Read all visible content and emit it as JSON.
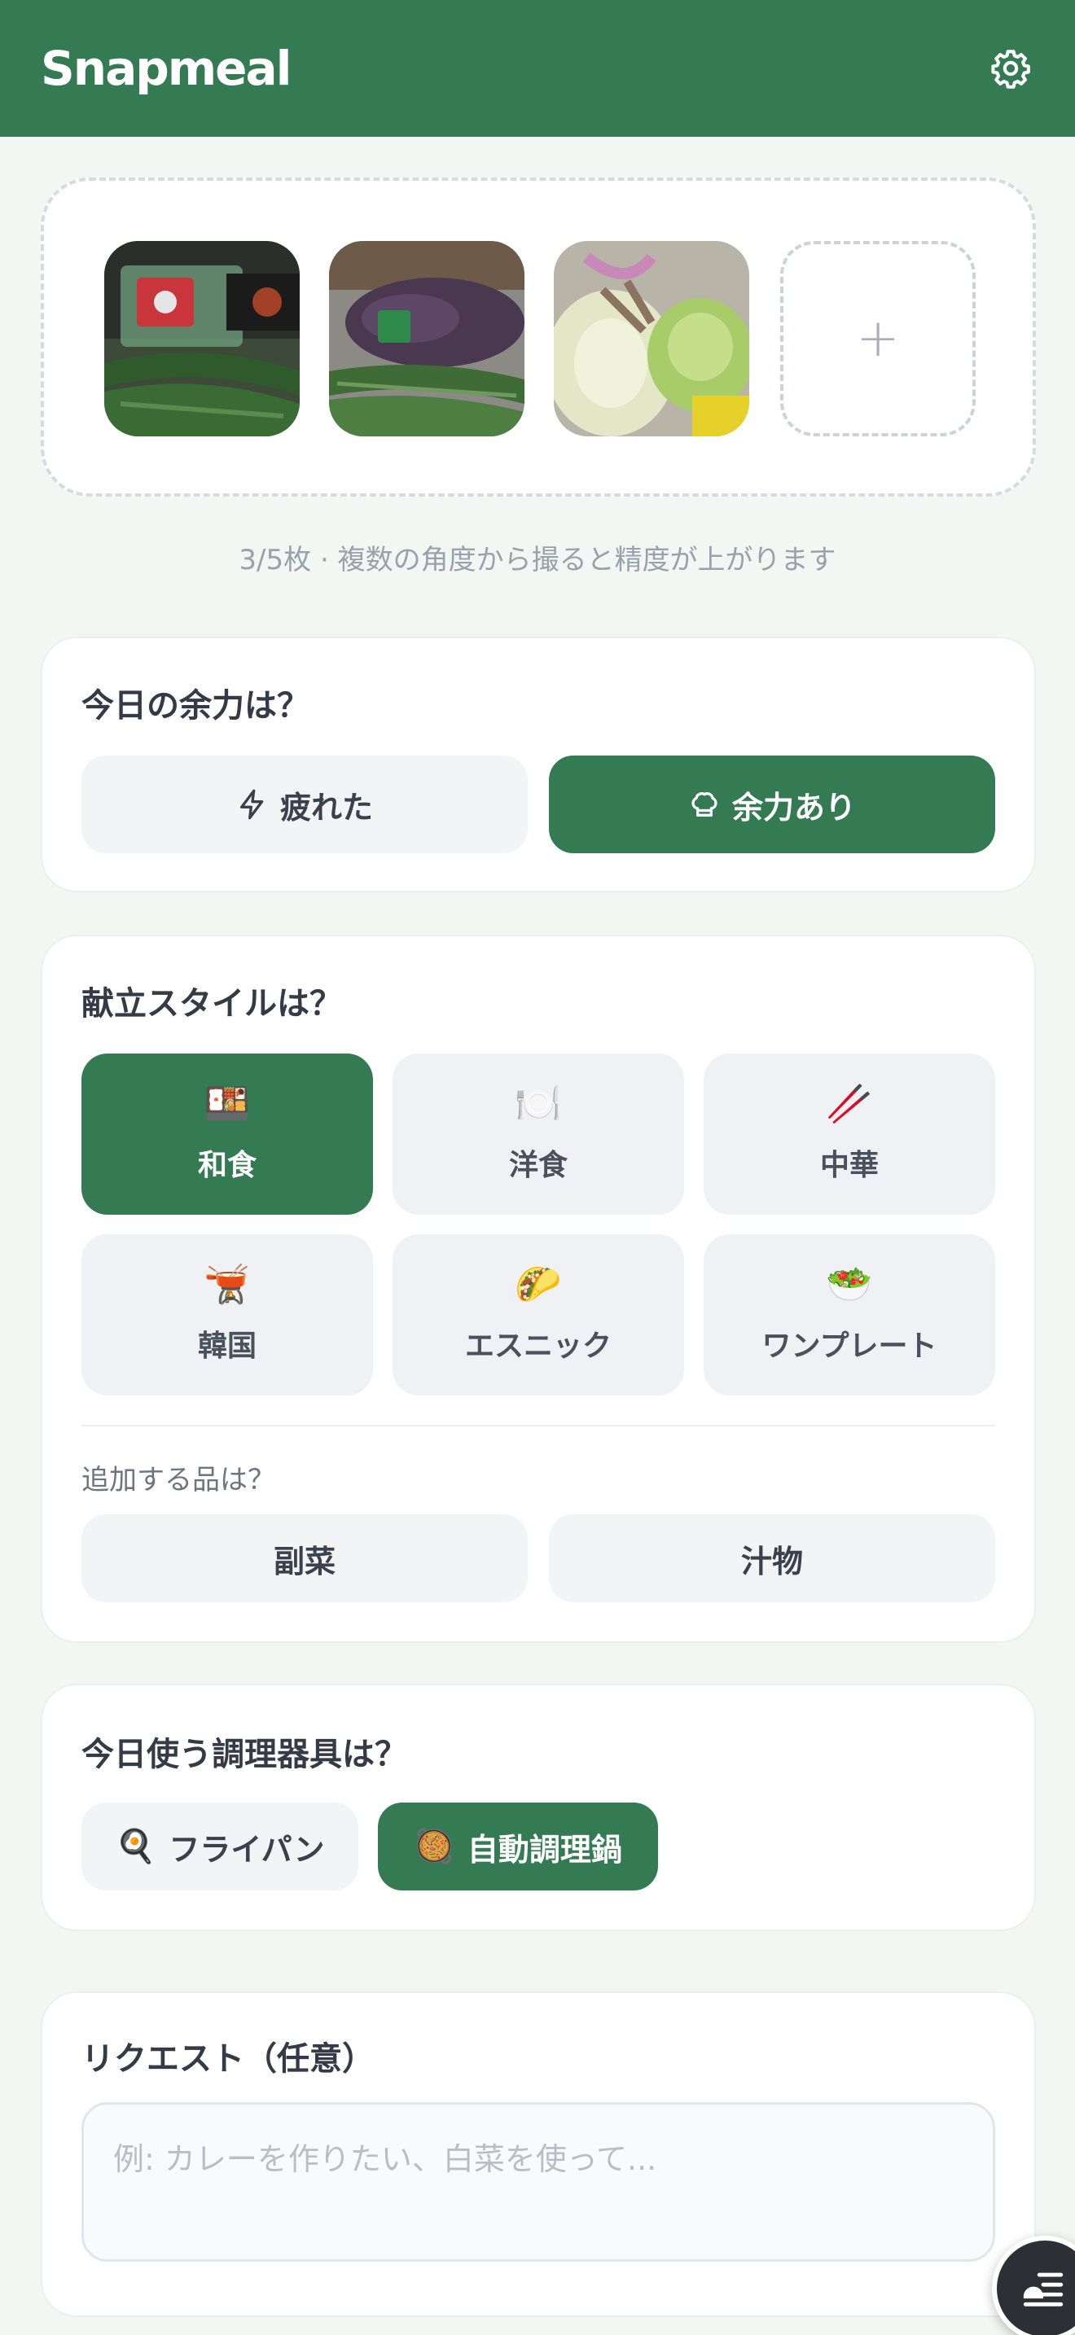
{
  "app": {
    "title": "Snapmeal",
    "settings_icon": "gear-icon",
    "brand_color": "#347a52"
  },
  "photos": {
    "items": [
      {
        "alt": "cucumbers-and-strawberries-photo"
      },
      {
        "alt": "eggplant-and-cucumbers-photo"
      },
      {
        "alt": "cabbage-and-lettuce-photo"
      }
    ],
    "add_label": "+",
    "hint": "3/5枚 · 複数の角度から撮ると精度が上がります"
  },
  "energy": {
    "title": "今日の余力は？",
    "options": [
      {
        "label": "疲れた",
        "icon": "lightning-icon",
        "selected": false
      },
      {
        "label": "余力あり",
        "icon": "chef-hat-icon",
        "selected": true
      }
    ]
  },
  "style": {
    "title": "献立スタイルは？",
    "options": [
      {
        "label": "和食",
        "emoji": "🍱",
        "selected": true
      },
      {
        "label": "洋食",
        "emoji": "🍽️",
        "selected": false
      },
      {
        "label": "中華",
        "emoji": "🥢",
        "selected": false
      },
      {
        "label": "韓国",
        "emoji": "🫕",
        "selected": false
      },
      {
        "label": "エスニック",
        "emoji": "🌮",
        "selected": false
      },
      {
        "label": "ワンプレート",
        "emoji": "🥗",
        "selected": false
      }
    ],
    "extra_title": "追加する品は？",
    "extras": [
      {
        "label": "副菜",
        "selected": false
      },
      {
        "label": "汁物",
        "selected": false
      }
    ]
  },
  "tools": {
    "title": "今日使う調理器具は？",
    "options": [
      {
        "label": "フライパン",
        "emoji": "🍳",
        "selected": false
      },
      {
        "label": "自動調理鍋",
        "emoji": "🥘",
        "selected": true
      }
    ]
  },
  "request": {
    "title": "リクエスト（任意）",
    "placeholder": "例: カレーを作りたい、白菜を使って...",
    "value": ""
  },
  "fab": {
    "icon": "menu-list-icon"
  }
}
